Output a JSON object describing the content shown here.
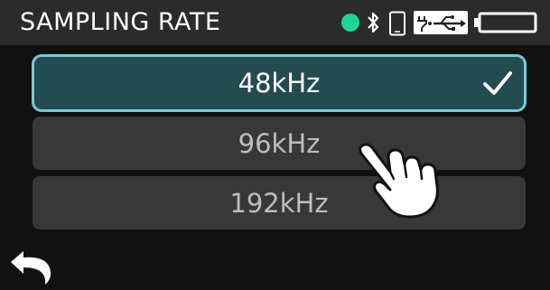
{
  "header": {
    "title": "SAMPLING RATE",
    "status_color": "#1ed39a",
    "icons": [
      "status-dot",
      "bluetooth-icon",
      "smartphone-icon",
      "usb-power-icon",
      "battery-icon"
    ]
  },
  "options": [
    {
      "label": "48kHz",
      "selected": true
    },
    {
      "label": "96kHz",
      "selected": false
    },
    {
      "label": "192kHz",
      "selected": false
    }
  ],
  "footer": {
    "back_icon": "back-arrow-icon"
  },
  "overlay": {
    "pointer_icon": "tap-hand-icon"
  },
  "colors": {
    "header_bg": "#2b2b2b",
    "selected_bg": "#244b50",
    "selected_border": "#79c8d8",
    "option_bg": "#383838"
  }
}
